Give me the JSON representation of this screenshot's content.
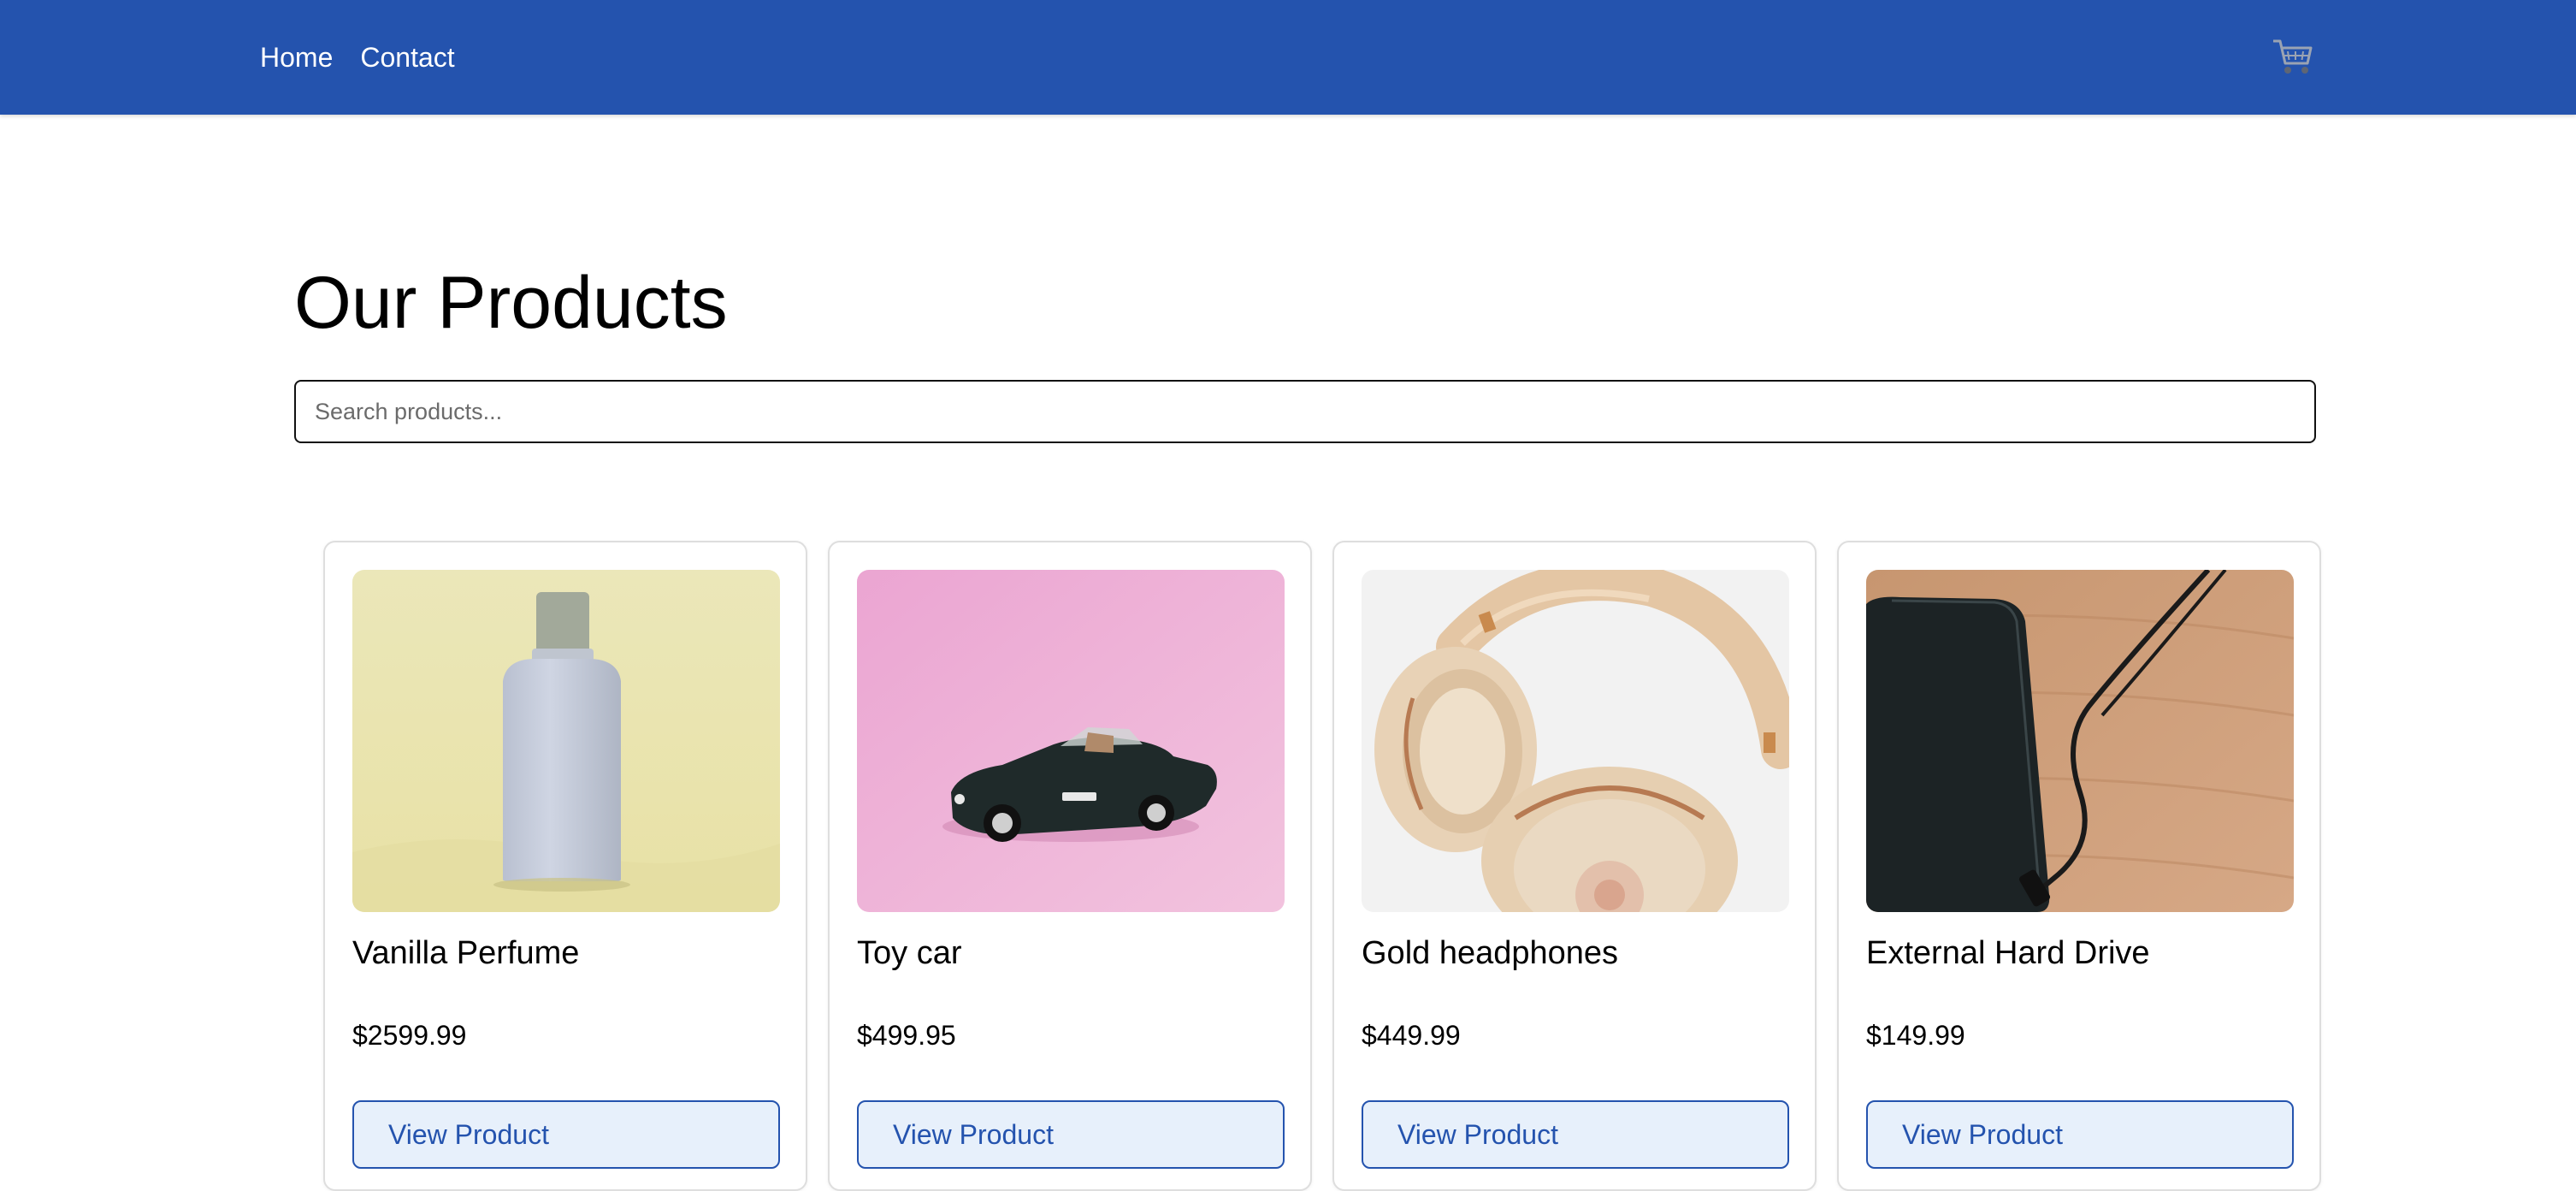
{
  "nav": {
    "links": [
      "Home",
      "Contact"
    ],
    "cart_icon": "shopping-cart-icon"
  },
  "main": {
    "title": "Our Products",
    "search_placeholder": "Search products..."
  },
  "products": [
    {
      "name": "Vanilla Perfume",
      "price": "$2599.99",
      "button": "View Product",
      "image": "perfume-bottle-photo"
    },
    {
      "name": "Toy car",
      "price": "$499.95",
      "button": "View Product",
      "image": "toy-car-photo"
    },
    {
      "name": "Gold headphones",
      "price": "$449.99",
      "button": "View Product",
      "image": "headphones-photo"
    },
    {
      "name": "External Hard Drive",
      "price": "$149.99",
      "button": "View Product",
      "image": "hard-drive-photo"
    }
  ],
  "colors": {
    "navbar": "#2453ae",
    "button_bg": "#e7f0fb",
    "button_text": "#2453ae"
  }
}
